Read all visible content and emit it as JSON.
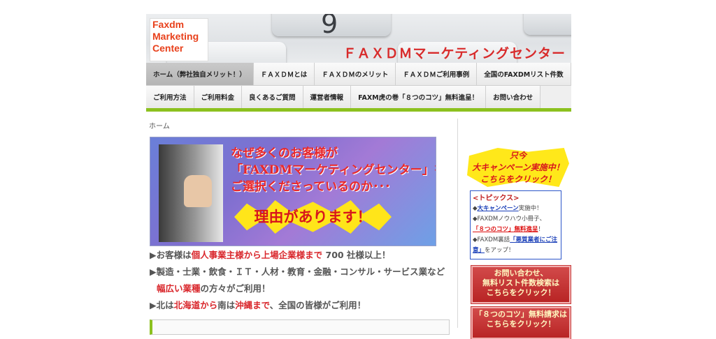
{
  "header": {
    "logo_lines": [
      "Faxdm",
      "Marketing",
      "Center"
    ],
    "site_title": "ＦＡＸＤＭマーケティングセンター",
    "key_digit": "9"
  },
  "nav": {
    "row1": [
      "ホーム（弊社独自メリット！）",
      "ＦＡＸＤＭとは",
      "ＦＡＸＤＭのメリット",
      "ＦＡＸＤＭご利用事例",
      "全国のFAXDMリスト件数"
    ],
    "row2": [
      "ご利用方法",
      "ご利用料金",
      "良くあるご質問",
      "運営者情報",
      "FAXM虎の巻「８つのコツ」無料進呈！",
      "お問い合わせ"
    ]
  },
  "breadcrumb": "ホーム",
  "banner": {
    "line1": "なぜ多くのお客様が",
    "line2": "「FAXDMマーケティングセンター」を",
    "line3": "ご選択くださっているのか･･･",
    "burst": "理由があります！"
  },
  "bullets": {
    "b1_pre": "▶お客様は",
    "b1_red": "個人事業主様から上場企業様まで",
    "b1_post": " 700 社様以上！",
    "b2": "▶製造・士業・飲食・ＩＴ・人材・教育・金融・コンサル・サービス業など",
    "b3_red": "幅広い業種",
    "b3_post": "の方々がご利用！",
    "b4_pre": "▶北は",
    "b4_red1": "北海道から",
    "b4_mid": "南は",
    "b4_red2": "沖縄まで",
    "b4_post": "、全国の皆様がご利用！"
  },
  "sidebar": {
    "campaign_line1": "只今",
    "campaign_line2": "大キャンペーン実施中！",
    "campaign_line3": "こちらをクリック！",
    "topics_head": "<トピックス>",
    "t1_pre": "◆",
    "t1_link": "大キャンペーン",
    "t1_post": "実施中！",
    "t2_pre": "◆FAXDMノウハウ小冊子、",
    "t2_link": "「８つのコツ」無料進呈",
    "t2_post": "！",
    "t3_pre": "◆FAXDM裏話",
    "t3_link": "「悪質業者にご注意」",
    "t3_post": "をアップ！",
    "btn1_line1": "お問い合わせ、",
    "btn1_line2": "無料リスト件数検索は",
    "btn1_line3": "こちらをクリック！",
    "btn2_line1": "「８つのコツ」無料請求は",
    "btn2_line2": "こちらをクリック！"
  }
}
